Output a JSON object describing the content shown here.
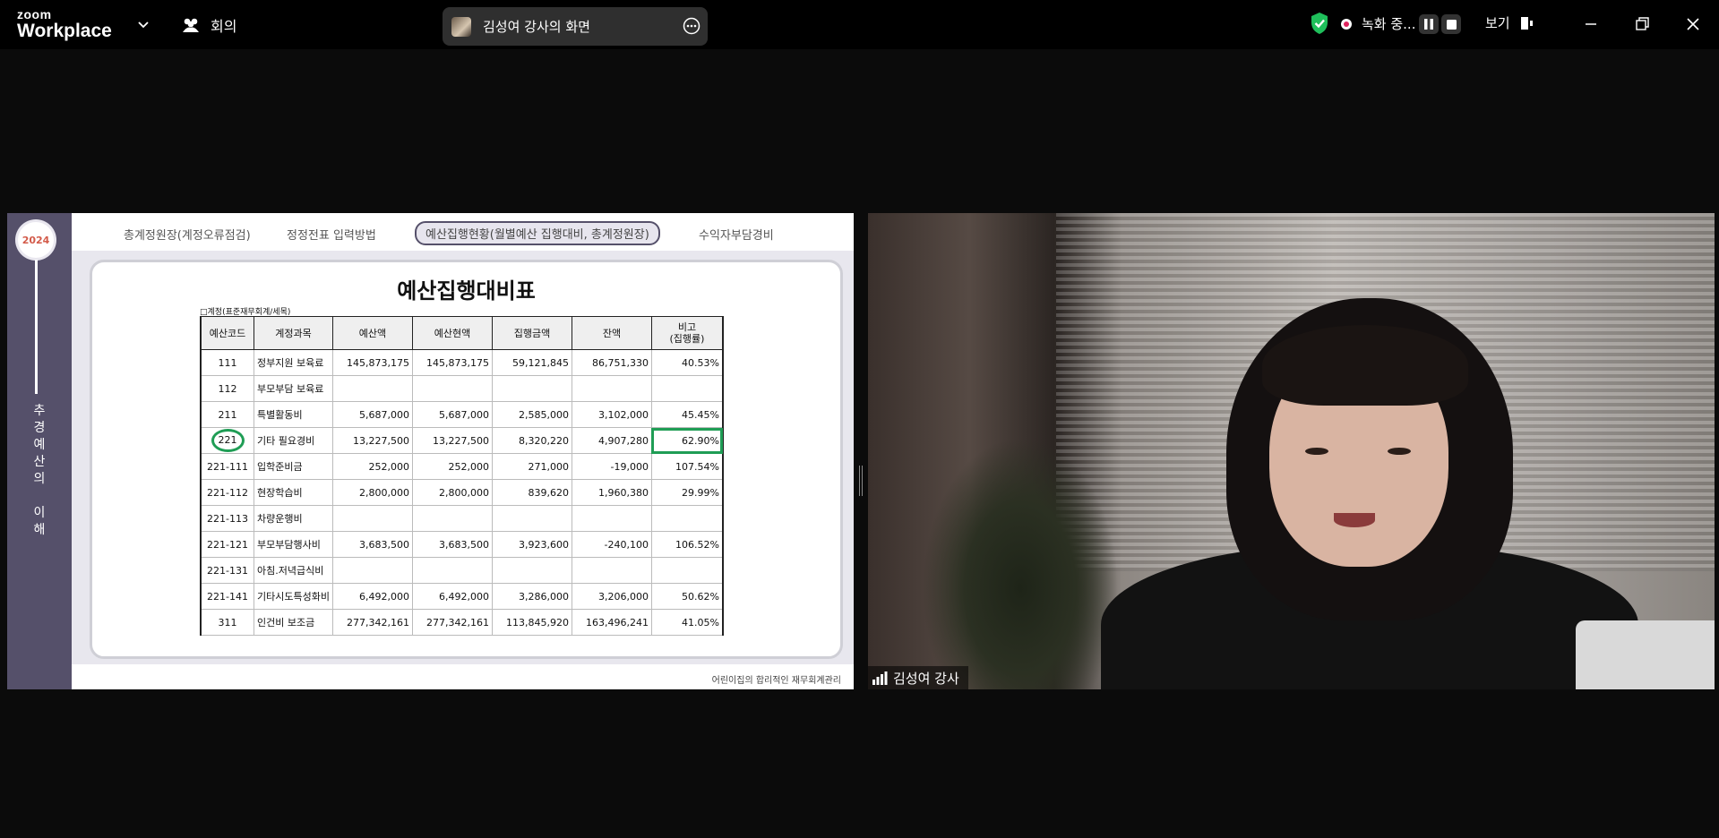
{
  "app": {
    "brand_small": "zoom",
    "brand_big": "Workplace",
    "meeting_label": "회의",
    "share_label": "김성여 강사의 화면",
    "recording_label": "녹화 중...",
    "view_label": "보기",
    "colors": {
      "record": "#e0245e",
      "shield": "#1fbf5b",
      "slide_sidebar": "#55506a",
      "highlight": "#1f9d55"
    }
  },
  "slide": {
    "year": "2024",
    "side_title": "추\n경\n예\n산\n의\n \n이\n해",
    "nav": [
      "총계정원장(계정오류점검)",
      "정정전표 입력방법",
      "예산집행현황(월별예산 집행대비, 총계정원장)",
      "수익자부담경비"
    ],
    "title": "예산집행대비표",
    "note": "□계정(표준재무회계/세목)",
    "headers": [
      "예산코드",
      "계정과목",
      "예산액",
      "예산현액",
      "집행금액",
      "잔액",
      "비고\n(집행률)"
    ],
    "rows": [
      [
        "111",
        "정부지원 보육료",
        "145,873,175",
        "145,873,175",
        "59,121,845",
        "86,751,330",
        "40.53%"
      ],
      [
        "112",
        "부모부담 보육료",
        "",
        "",
        "",
        "",
        ""
      ],
      [
        "211",
        "특별활동비",
        "5,687,000",
        "5,687,000",
        "2,585,000",
        "3,102,000",
        "45.45%"
      ],
      [
        "221",
        "기타 필요경비",
        "13,227,500",
        "13,227,500",
        "8,320,220",
        "4,907,280",
        "62.90%"
      ],
      [
        "221-111",
        "입학준비금",
        "252,000",
        "252,000",
        "271,000",
        "-19,000",
        "107.54%"
      ],
      [
        "221-112",
        "현장학습비",
        "2,800,000",
        "2,800,000",
        "839,620",
        "1,960,380",
        "29.99%"
      ],
      [
        "221-113",
        "차량운행비",
        "",
        "",
        "",
        "",
        ""
      ],
      [
        "221-121",
        "부모부담행사비",
        "3,683,500",
        "3,683,500",
        "3,923,600",
        "-240,100",
        "106.52%"
      ],
      [
        "221-131",
        "아침.저녁급식비",
        "",
        "",
        "",
        "",
        ""
      ],
      [
        "221-141",
        "기타시도특성화비",
        "6,492,000",
        "6,492,000",
        "3,286,000",
        "3,206,000",
        "50.62%"
      ],
      [
        "311",
        "인건비 보조금",
        "277,342,161",
        "277,342,161",
        "113,845,920",
        "163,496,241",
        "41.05%"
      ]
    ],
    "footer": "어린이집의 합리적인 재무회계관리"
  },
  "video": {
    "participant_name": "김성여 강사"
  }
}
